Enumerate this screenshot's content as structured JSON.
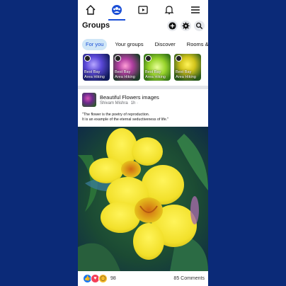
{
  "nav": {
    "items": [
      {
        "icon": "home-icon"
      },
      {
        "icon": "groups-icon",
        "active": true
      },
      {
        "icon": "video-icon"
      },
      {
        "icon": "bell-icon"
      },
      {
        "icon": "menu-icon"
      }
    ]
  },
  "header": {
    "title": "Groups",
    "icons": [
      "plus-icon",
      "gear-icon",
      "search-icon"
    ]
  },
  "tabs": [
    {
      "label": "For you",
      "active": true
    },
    {
      "label": "Your groups"
    },
    {
      "label": "Discover"
    },
    {
      "label": "Rooms &"
    }
  ],
  "group_cards": [
    {
      "label": "Best Bay Area Hiking"
    },
    {
      "label": "Best Bay Area Hiking"
    },
    {
      "label": "Best Bay Area Hiking"
    },
    {
      "label": "Best Bay Area Hiking"
    }
  ],
  "post": {
    "group_name": "Beautiful Flowers images",
    "author": "Shivam Mishra",
    "time": "1h ·",
    "text_line1": "\"The flower is the poetry of reproduction.",
    "text_line2": "It is an example of the eternal seductiveness of life.\"",
    "reaction_count": "98",
    "comments": "85 Comments"
  },
  "colors": {
    "background": "#0b2a78",
    "accent": "#1b4fd6",
    "chip_active_bg": "#cfe6f7",
    "like": "#1877f2",
    "love": "#f33e58",
    "wow": "#f7b928"
  }
}
